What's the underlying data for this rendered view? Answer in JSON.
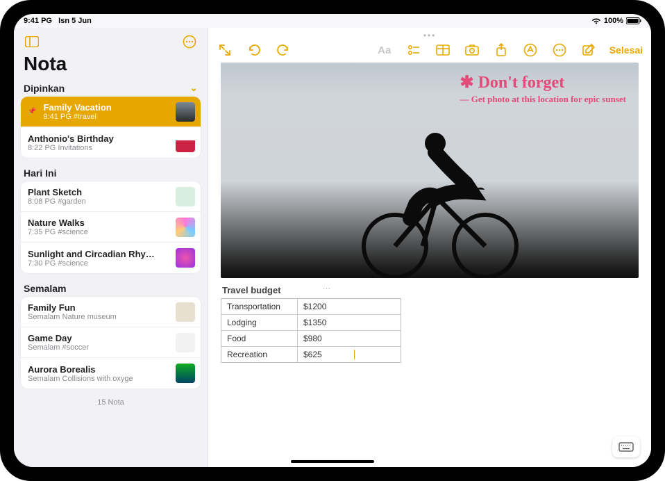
{
  "status": {
    "time": "9:41 PG",
    "date": "Isn 5 Jun",
    "battery": "100%"
  },
  "sidebar": {
    "title": "Nota",
    "sections": [
      {
        "name": "Dipinkan"
      },
      {
        "name": "Hari Ini"
      },
      {
        "name": "Semalam"
      }
    ],
    "footer": "15 Nota",
    "pinned": [
      {
        "title": "Family Vacation",
        "sub": "9:41 PG  #travel"
      },
      {
        "title": "Anthonio's Birthday",
        "sub": "8:22 PG  Invitations"
      }
    ],
    "today": [
      {
        "title": "Plant Sketch",
        "sub": "8:08 PG  #garden"
      },
      {
        "title": "Nature Walks",
        "sub": "7:35 PG  #science"
      },
      {
        "title": "Sunlight and Circadian Rhy…",
        "sub": "7:30 PG  #science"
      }
    ],
    "yesterday": [
      {
        "title": "Family Fun",
        "sub": "Semalam  Nature museum"
      },
      {
        "title": "Game Day",
        "sub": "Semalam  #soccer"
      },
      {
        "title": "Aurora Borealis",
        "sub": "Semalam  Collisions with oxyge"
      }
    ]
  },
  "toolbar": {
    "done": "Selesai"
  },
  "note": {
    "annotation_title": "✱ Don't forget",
    "annotation_body": "— Get photo at this location for epic sunset",
    "table_title": "Travel budget",
    "budget": [
      {
        "label": "Transportation",
        "value": "$1200"
      },
      {
        "label": "Lodging",
        "value": "$1350"
      },
      {
        "label": "Food",
        "value": "$980"
      },
      {
        "label": "Recreation",
        "value": "$625"
      }
    ]
  }
}
